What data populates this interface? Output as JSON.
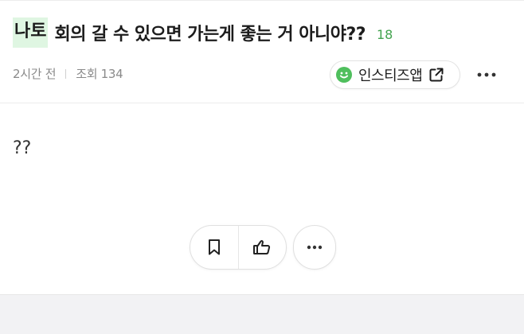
{
  "post": {
    "category": "나토",
    "title": "회의 갈 수 있으면 가는게 좋는 거 아니야??",
    "comment_count": "18",
    "time_ago": "2시간 전",
    "views": "조회 134",
    "body": "??"
  },
  "app_button": {
    "label": "인스티즈앱"
  },
  "icons": {
    "app": "smile-icon",
    "external": "external-link-icon",
    "more": "more-horizontal-icon",
    "bookmark": "bookmark-icon",
    "like": "thumbs-up-icon"
  },
  "colors": {
    "accent_green": "#43a34f",
    "tag_background": "#dff6e2",
    "page_background": "#f2f2f4"
  }
}
